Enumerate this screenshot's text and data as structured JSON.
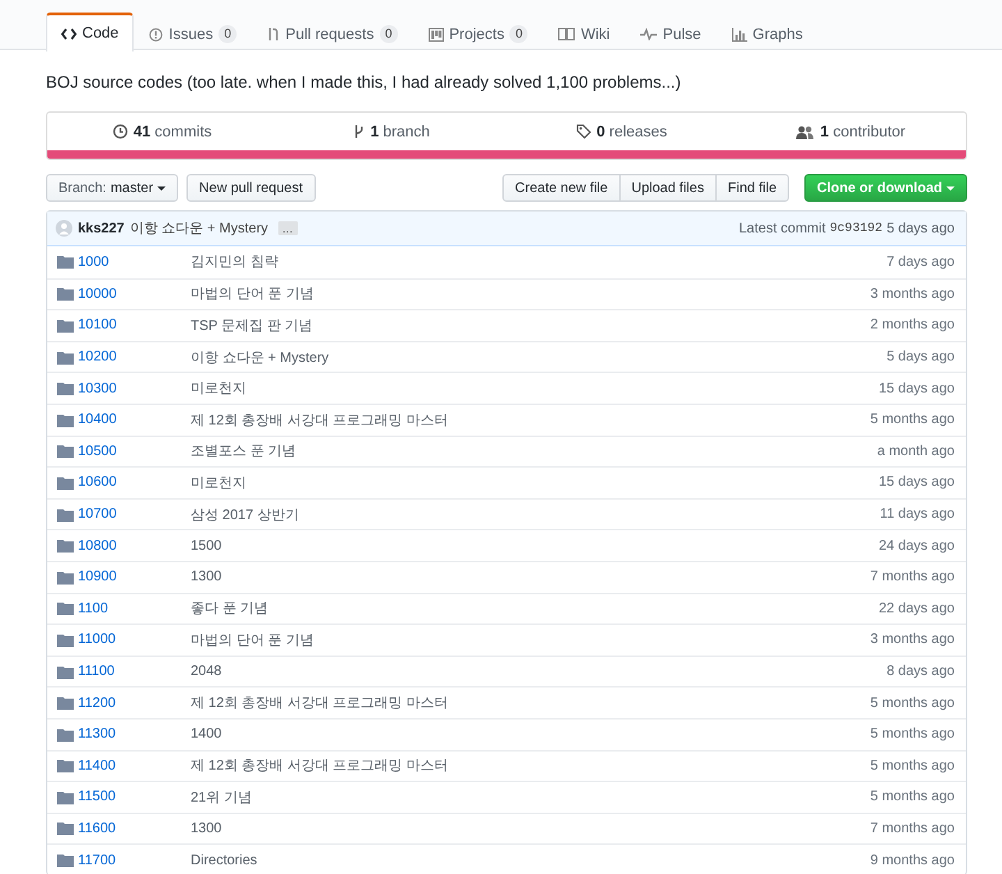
{
  "tabs": [
    {
      "label": "Code",
      "selected": true
    },
    {
      "label": "Issues",
      "count": "0",
      "selected": false
    },
    {
      "label": "Pull requests",
      "count": "0",
      "selected": false
    },
    {
      "label": "Projects",
      "count": "0",
      "selected": false
    },
    {
      "label": "Wiki",
      "selected": false
    },
    {
      "label": "Pulse",
      "selected": false
    },
    {
      "label": "Graphs",
      "selected": false
    }
  ],
  "description": "BOJ source codes (too late. when I made this, I had already solved 1,100 problems...)",
  "summary": [
    {
      "count": "41",
      "label": "commits"
    },
    {
      "count": "1",
      "label": "branch"
    },
    {
      "count": "0",
      "label": "releases"
    },
    {
      "count": "1",
      "label": "contributor"
    }
  ],
  "toolbar": {
    "branch_label": "Branch:",
    "branch": "master",
    "new_pull_request": "New pull request",
    "buttons": [
      "Create new file",
      "Upload files",
      "Find file"
    ],
    "clone": "Clone or download"
  },
  "commit": {
    "author": "kks227",
    "message": "이항 쇼다운 + Mystery",
    "more": "…",
    "latest": "Latest commit",
    "sha": "9c93192",
    "age": "5 days ago"
  },
  "files": [
    {
      "name": "1000",
      "message": "김지민의 침략",
      "age": "7 days ago"
    },
    {
      "name": "10000",
      "message": "마법의 단어 푼 기념",
      "age": "3 months ago"
    },
    {
      "name": "10100",
      "message": "TSP 문제집 판 기념",
      "age": "2 months ago"
    },
    {
      "name": "10200",
      "message": "이항 쇼다운 + Mystery",
      "age": "5 days ago"
    },
    {
      "name": "10300",
      "message": "미로천지",
      "age": "15 days ago"
    },
    {
      "name": "10400",
      "message": "제 12회 총장배 서강대 프로그래밍 마스터",
      "age": "5 months ago"
    },
    {
      "name": "10500",
      "message": "조별포스 푼 기념",
      "age": "a month ago"
    },
    {
      "name": "10600",
      "message": "미로천지",
      "age": "15 days ago"
    },
    {
      "name": "10700",
      "message": "삼성 2017 상반기",
      "age": "11 days ago"
    },
    {
      "name": "10800",
      "message": "1500",
      "age": "24 days ago"
    },
    {
      "name": "10900",
      "message": "1300",
      "age": "7 months ago"
    },
    {
      "name": "1100",
      "message": "좋다 푼 기념",
      "age": "22 days ago"
    },
    {
      "name": "11000",
      "message": "마법의 단어 푼 기념",
      "age": "3 months ago"
    },
    {
      "name": "11100",
      "message": "2048",
      "age": "8 days ago"
    },
    {
      "name": "11200",
      "message": "제 12회 총장배 서강대 프로그래밍 마스터",
      "age": "5 months ago"
    },
    {
      "name": "11300",
      "message": "1400",
      "age": "5 months ago"
    },
    {
      "name": "11400",
      "message": "제 12회 총장배 서강대 프로그래밍 마스터",
      "age": "5 months ago"
    },
    {
      "name": "11500",
      "message": "21위 기념",
      "age": "5 months ago"
    },
    {
      "name": "11600",
      "message": "1300",
      "age": "7 months ago"
    },
    {
      "name": "11700",
      "message": "Directories",
      "age": "9 months ago"
    }
  ]
}
